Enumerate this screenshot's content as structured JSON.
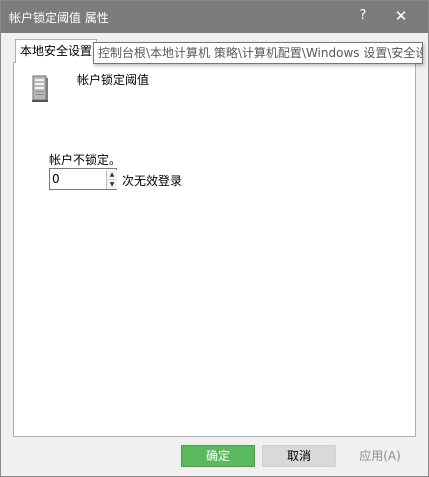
{
  "window": {
    "title": "帐户锁定阈值 属性",
    "help_glyph": "?",
    "close_glyph": "✕"
  },
  "tabs": [
    {
      "label": "本地安全设置",
      "active": true
    }
  ],
  "tooltip": {
    "text": "控制台根\\本地计算机 策略\\计算机配置\\Windows 设置\\安全设置"
  },
  "policy": {
    "icon": "server-icon",
    "name": "帐户锁定阈值"
  },
  "lockout": {
    "label": "帐户不锁定。",
    "value": "0",
    "unit_label": "次无效登录"
  },
  "buttons": {
    "ok": "确定",
    "cancel": "取消",
    "apply": "应用(A)"
  },
  "colors": {
    "titlebar": "#7c7c7c",
    "ok_button": "#5cb85c",
    "cancel_button": "#d9d9d9"
  }
}
